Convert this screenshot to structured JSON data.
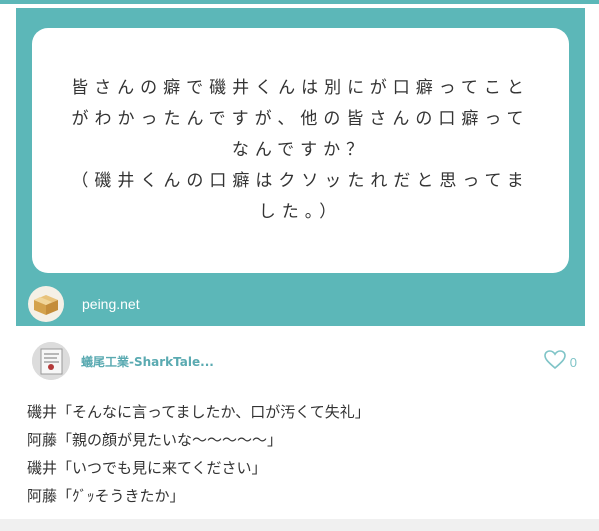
{
  "question": {
    "text": "皆さんの癖で磯井くんは別にが口癖ってことがわかったんですが、他の皆さんの口癖ってなんですか？\n（磯井くんの口癖はクソッたれだと思ってました。）"
  },
  "brand": {
    "name": "peing.net",
    "logo_icon": "cardboard-box-icon"
  },
  "author": {
    "name": "蟻尾工業-SharkTale...",
    "avatar_icon": "user-avatar-icon"
  },
  "likes": {
    "count": "0",
    "icon": "heart-outline-icon"
  },
  "answer": {
    "lines": [
      "磯井「そんなに言ってましたか、口が汚くて失礼」",
      "阿藤「親の顔が見たいな〜〜〜〜〜」",
      "磯井「いつでも見に来てください」",
      "阿藤「ｸﾞｯそうきたか」"
    ]
  },
  "colors": {
    "accent": "#5cb7b8",
    "author_name": "#5aaab1",
    "heart": "#7fc4c7",
    "text": "#333333"
  }
}
